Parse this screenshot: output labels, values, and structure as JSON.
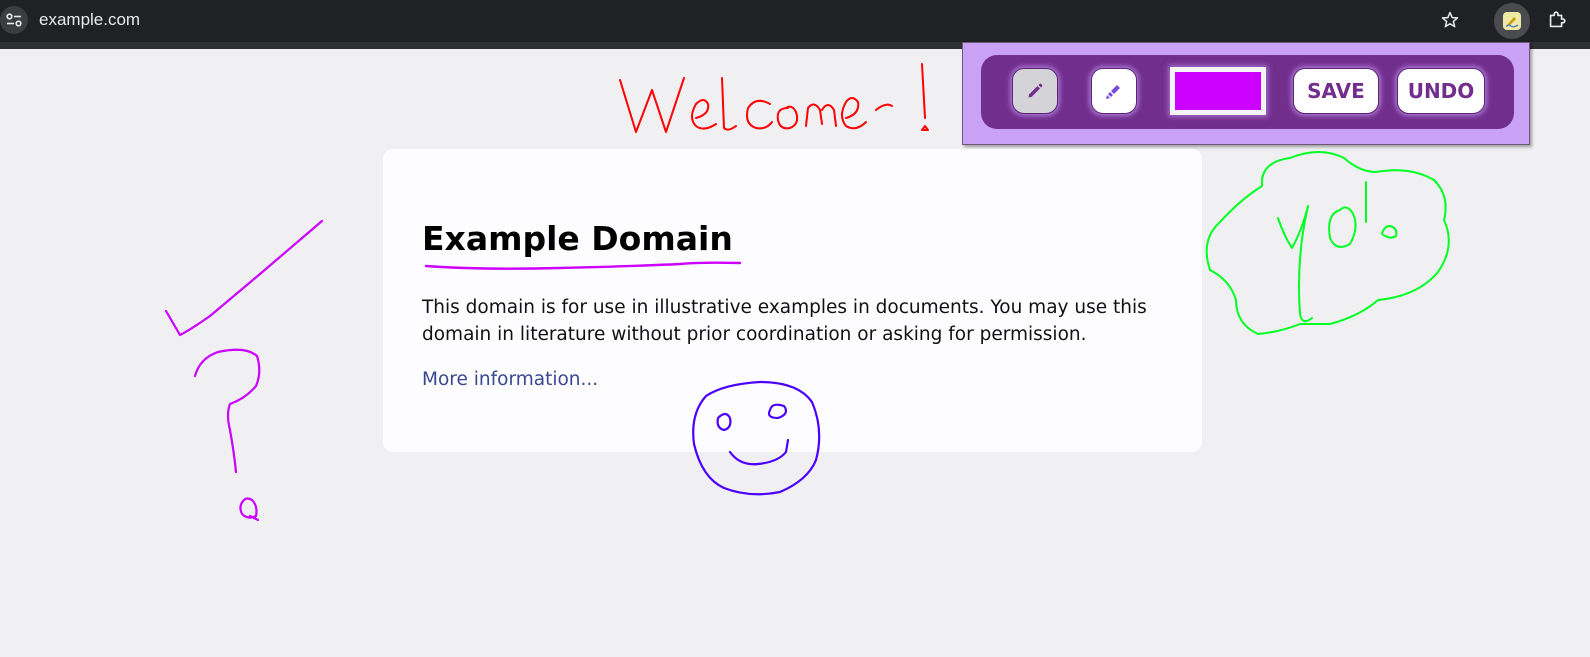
{
  "browser": {
    "url": "example.com",
    "icons": {
      "site_info": "site-info-icon",
      "bookmark": "star-icon",
      "extension": "annotation-extension-icon",
      "extensions_menu": "puzzle-icon"
    }
  },
  "page": {
    "title": "Example Domain",
    "description": "This domain is for use in illustrative examples in documents. You may use this domain in literature without prior coordination or asking for permission.",
    "link_text": "More information..."
  },
  "toolbar": {
    "pen_icon": "pencil-icon",
    "marker_icon": "highlighter-icon",
    "selected_color": "#cc00ff",
    "save_label": "SAVE",
    "undo_label": "UNDO",
    "accent": "#722e8c"
  },
  "drawings": {
    "welcome_text": "Welcome!",
    "yo_text": "yo!",
    "colors": {
      "welcome": "#ff0000",
      "checkmark": "#cc00ff",
      "question": "#cc00ff",
      "smiley": "#4b00ff",
      "cloud": "#00ff22",
      "underline": "#cc00ff"
    }
  }
}
